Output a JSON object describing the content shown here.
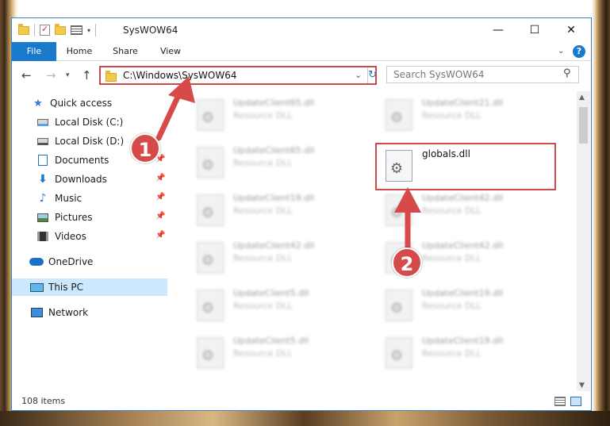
{
  "window": {
    "title": "SysWOW64",
    "min_glyph": "—",
    "max_glyph": "☐",
    "close_glyph": "✕"
  },
  "ribbon": {
    "tabs": [
      "File",
      "Home",
      "Share",
      "View"
    ],
    "help_glyph": "?"
  },
  "address": {
    "path": "C:\\Windows\\SysWOW64",
    "search_placeholder": "Search SysWOW64"
  },
  "nav": [
    {
      "label": "Quick access",
      "icon": "star-icon",
      "pinned": false
    },
    {
      "label": "Local Disk (C:)",
      "icon": "drive-icon",
      "pinned": false
    },
    {
      "label": "Local Disk (D:)",
      "icon": "drive-icon",
      "pinned": false
    },
    {
      "label": "Documents",
      "icon": "documents-icon",
      "pinned": true
    },
    {
      "label": "Downloads",
      "icon": "downloads-icon",
      "pinned": true
    },
    {
      "label": "Music",
      "icon": "music-icon",
      "pinned": true
    },
    {
      "label": "Pictures",
      "icon": "pictures-icon",
      "pinned": true
    },
    {
      "label": "Videos",
      "icon": "videos-icon",
      "pinned": true
    },
    {
      "label": "OneDrive",
      "icon": "onedrive-icon",
      "pinned": false
    },
    {
      "label": "This PC",
      "icon": "this-pc-icon",
      "pinned": false,
      "selected": true
    },
    {
      "label": "Network",
      "icon": "network-icon",
      "pinned": false
    }
  ],
  "files": {
    "left_column": [
      {
        "name": "UpdateClient65.dll",
        "type": "Resource DLL"
      },
      {
        "name": "UpdateClient65.dll",
        "type": "Resource DLL"
      },
      {
        "name": "UpdateClient19.dll",
        "type": "Resource DLL"
      },
      {
        "name": "UpdateClient42.dll",
        "type": "Resource DLL"
      },
      {
        "name": "UpdateClient5.dll",
        "type": "Resource DLL"
      },
      {
        "name": "UpdateClient5.dll",
        "type": "Resource DLL"
      }
    ],
    "right_column": [
      {
        "name": "UpdateClient21.dll",
        "type": "Resource DLL"
      },
      {
        "name": "globals.dll",
        "type": "",
        "highlighted": true
      },
      {
        "name": "UpdateClient42.dll",
        "type": "Resource DLL"
      },
      {
        "name": "UpdateClient42.dll",
        "type": "Resource DLL"
      },
      {
        "name": "UpdateClient19.dll",
        "type": "Resource DLL"
      },
      {
        "name": "UpdateClient19.dll",
        "type": "Resource DLL"
      }
    ]
  },
  "status": {
    "item_count": "108 items"
  },
  "annotations": {
    "step1": "1",
    "step2": "2",
    "color": "#d64a4a"
  }
}
